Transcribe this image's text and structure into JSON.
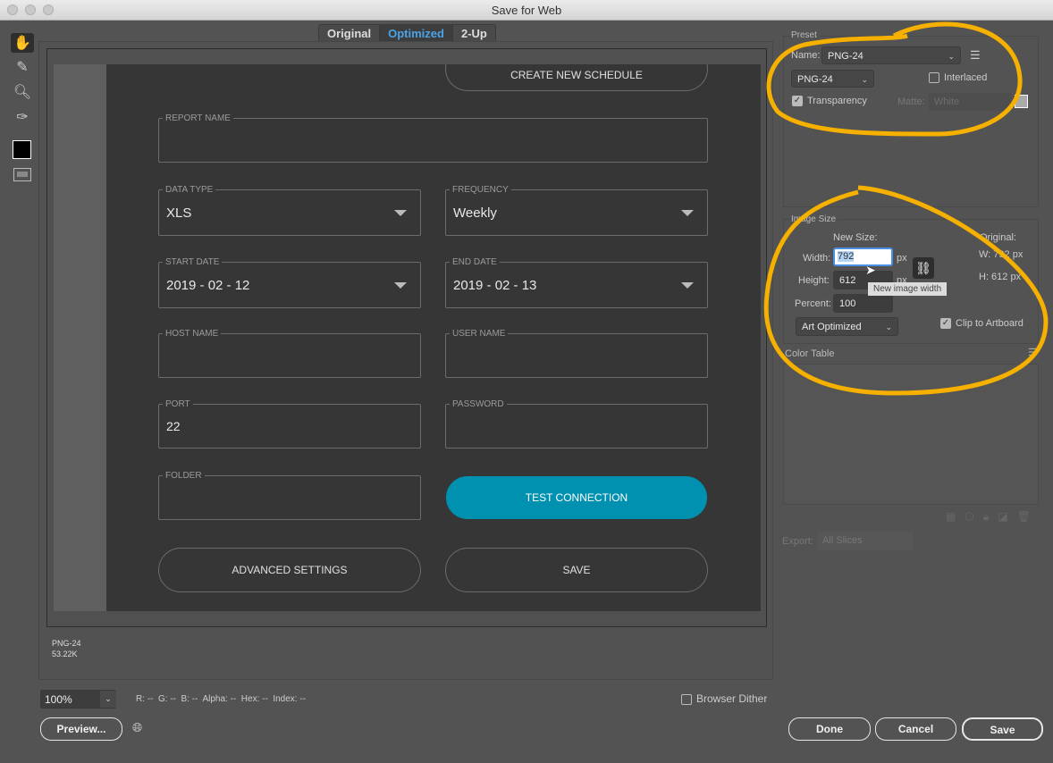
{
  "window": {
    "title": "Save for Web"
  },
  "tabs": [
    {
      "label": "Original"
    },
    {
      "label": "Optimized",
      "active": true
    },
    {
      "label": "2-Up"
    }
  ],
  "tools": [
    "hand-icon",
    "slice-select-icon",
    "zoom-icon",
    "eyedropper-icon",
    "eyedropper-color-swatch",
    "toggle-slices-icon"
  ],
  "preview_image": {
    "create_schedule": "CREATE NEW SCHEDULE",
    "report_name": {
      "label": "REPORT NAME",
      "value": ""
    },
    "data_type": {
      "label": "DATA TYPE",
      "value": "XLS"
    },
    "frequency": {
      "label": "FREQUENCY",
      "value": "Weekly"
    },
    "start_date": {
      "label": "START DATE",
      "value": "2019 - 02 - 12"
    },
    "end_date": {
      "label": "END DATE",
      "value": "2019 - 02 - 13"
    },
    "host_name": {
      "label": "HOST NAME",
      "value": ""
    },
    "user_name": {
      "label": "USER NAME",
      "value": ""
    },
    "port": {
      "label": "PORT",
      "value": "22"
    },
    "password": {
      "label": "PASSWORD",
      "value": ""
    },
    "folder": {
      "label": "FOLDER",
      "value": ""
    },
    "test_connection": "TEST CONNECTION",
    "advanced_settings": "ADVANCED SETTINGS",
    "save": "SAVE",
    "accent": "#0090b0"
  },
  "image_info": {
    "format": "PNG-24",
    "size": "53.22K"
  },
  "zoom": {
    "value": "100%"
  },
  "pixel_info": "R: --  G: --  B: --  Alpha: --  Hex: --  Index: --",
  "browser_dither": {
    "label": "Browser Dither",
    "checked": false
  },
  "preview_button": "Preview...",
  "preset": {
    "title": "Preset",
    "name_label": "Name:",
    "name_value": "PNG-24",
    "format": "PNG-24",
    "interlaced": {
      "label": "Interlaced",
      "checked": false
    },
    "transparency": {
      "label": "Transparency",
      "checked": true
    },
    "matte_label": "Matte:",
    "matte_value": "White"
  },
  "image_size": {
    "title": "Image Size",
    "new_size": "New Size:",
    "width_label": "Width:",
    "width": "792",
    "height_label": "Height:",
    "height": "612",
    "percent_label": "Percent:",
    "percent": "100",
    "unit": "px",
    "original_label": "Original:",
    "orig_w": "W:  792 px",
    "orig_h": "H:  612 px",
    "tooltip": "New image width",
    "quality": "Art Optimized",
    "clip": {
      "label": "Clip to Artboard",
      "checked": true
    }
  },
  "color_table": {
    "title": "Color Table"
  },
  "export": {
    "label": "Export:",
    "value": "All Slices"
  },
  "buttons": {
    "done": "Done",
    "cancel": "Cancel",
    "save": "Save"
  },
  "annotation_color": "#f5b000"
}
